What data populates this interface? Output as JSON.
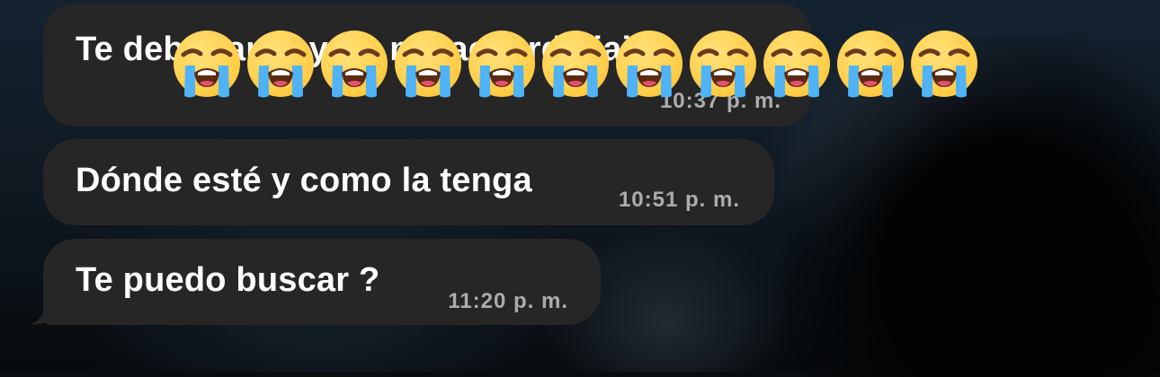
{
  "messages": [
    {
      "text": "Te debo tanto y no me acuerdo jajaja",
      "time": "10:37 p. m."
    },
    {
      "text": "Dónde esté y como la tenga",
      "time": "10:51 p. m."
    },
    {
      "text": "Te puedo buscar ?",
      "time": "11:20 p. m."
    }
  ],
  "emoji_overlay": {
    "icon": "loudly-crying-face",
    "count": 11
  },
  "colors": {
    "bubble": "#262626",
    "text": "#ffffff",
    "emoji_face": "#FFC83D",
    "tears": "#4FB3F6"
  }
}
